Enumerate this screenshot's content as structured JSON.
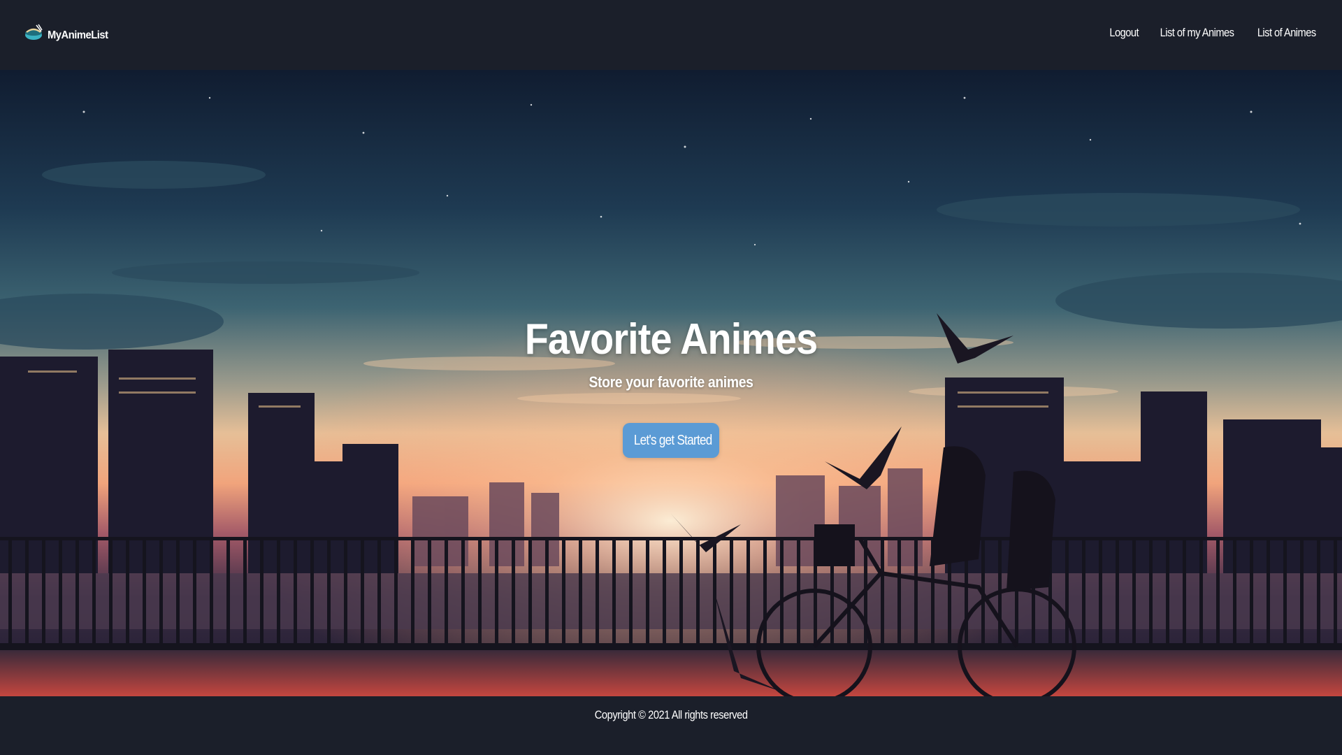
{
  "brand": {
    "name": "MyAnimeList",
    "logo_icon": "anime-bowl-logo-icon"
  },
  "nav": {
    "items": [
      {
        "label": "Logout"
      },
      {
        "label": "List of my Animes"
      },
      {
        "label": "List of Animes"
      }
    ]
  },
  "hero": {
    "title": "Favorite Animes",
    "subtitle": "Store your favorite animes",
    "cta_label": "Let's get Started",
    "background": "sunset-city-bridge-illustration"
  },
  "footer": {
    "copyright": "Copyright © 2021 All rights reserved"
  },
  "colors": {
    "navbar_bg": "#1b1f2a",
    "cta_bg": "#5b9bd5",
    "text": "#ffffff"
  }
}
